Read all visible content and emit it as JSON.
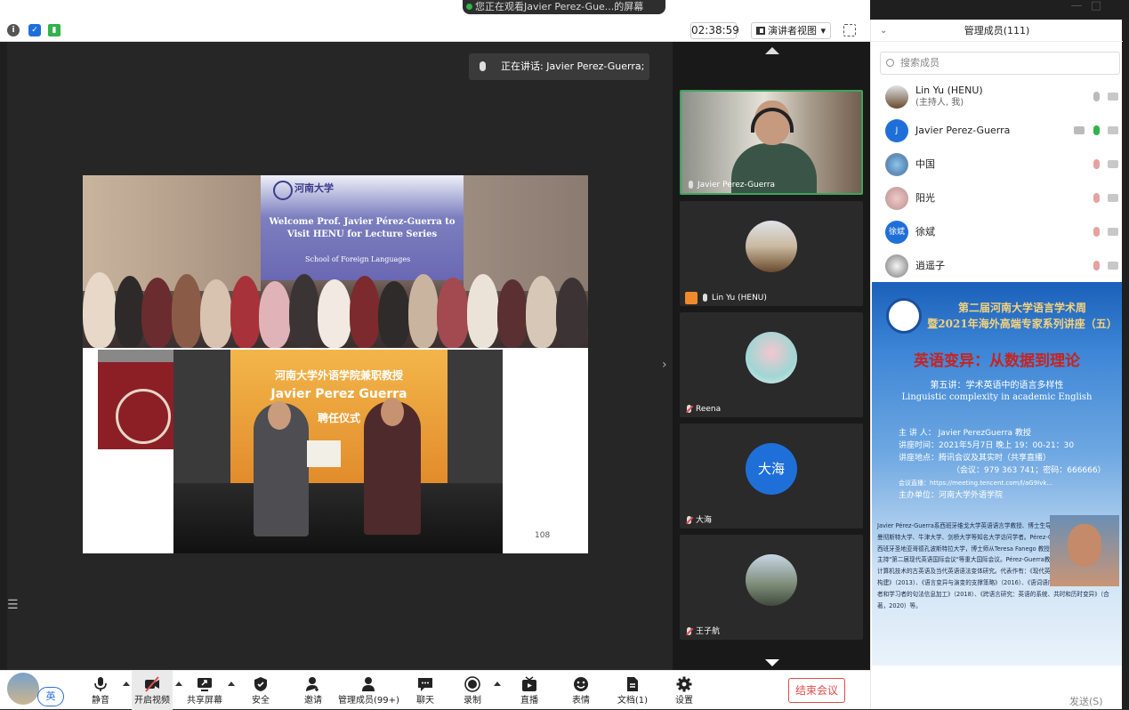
{
  "window": {
    "title": "您正在观看Javier Perez-Gue...的屏幕",
    "minimize": "—",
    "maximize": "□"
  },
  "infobar": {
    "timer": "02:38:59",
    "view_label": "演讲者视图",
    "view_caret": "▾"
  },
  "stage": {
    "speaking": "正在讲话: Javier Perez-Guerra;",
    "right_arrow": "›",
    "left_menu": "☰",
    "slide": {
      "logo_text": "河南大学",
      "welcome": "Welcome Prof. Javier Pérez-Guerra to Visit HENU for Lecture Series",
      "school": "School of Foreign Languages",
      "banner_l1": "河南大学外语学院兼职教授",
      "banner_l2": "Javier Perez Guerra",
      "banner_l3": "聘任仪式",
      "page_number": "108"
    }
  },
  "video_tiles": [
    {
      "name": "Javier Perez-Guerra",
      "state": "speaking"
    },
    {
      "name": "Lin Yu (HENU)",
      "state": "host"
    },
    {
      "name": "Reena",
      "state": "muted"
    },
    {
      "name": "大海",
      "state": "muted",
      "avatar_text": "大海"
    },
    {
      "name": "王子航",
      "state": "muted"
    }
  ],
  "panel": {
    "title": "管理成员(111)",
    "chevron": "⌄",
    "search_placeholder": "搜索成员",
    "members": [
      {
        "name": "Lin Yu (HENU)",
        "sub": "(主持人, 我)",
        "mic": "off",
        "cam": "off"
      },
      {
        "name": "Javier Perez-Guerra",
        "avatar": "J",
        "mic": "on",
        "cam": "off"
      },
      {
        "name": "中国",
        "mic": "muted",
        "cam": "off"
      },
      {
        "name": "阳光",
        "mic": "muted",
        "cam": "off"
      },
      {
        "name": "徐斌",
        "avatar": "徐斌",
        "mic": "muted",
        "cam": "off"
      },
      {
        "name": "逍遥子",
        "mic": "muted",
        "cam": "off"
      }
    ],
    "send_label": "发送(S)"
  },
  "poster": {
    "title_line1": "第二届河南大学语言学术周",
    "title_line2": "暨2021年海外高端专家系列讲座（五）",
    "main_title": "英语变异：从数据到理论",
    "sub_cn": "第五讲：学术英语中的语言多样性",
    "sub_en": "Linguistic complexity in academic English",
    "lines": [
      "主 讲 人：  Javier PerezGuerra  教授",
      "讲座时间：2021年5月7日 晚上 19：00-21：30",
      "讲座地点：腾讯会议及其实时（共享直播）",
      "（会议：979 363 741；密码：666666）",
      "会议直播：https://meeting.tencent.com/l/aG9Ivk...",
      "主办单位：河南大学外语学院"
    ],
    "bio": "Javier Pérez-Guerra系西班牙维戈大学英语语言学教授、博士生导师，知名学术期刊编辑，曼彻斯特大学、牛津大学、剑桥大学等知名大学访问学者。Pérez-Guerra教授暗博导毕业于西班牙圣地亚哥德孔波斯特拉大学，博士师从Teresa Fanego 教授。Pérez-Guerra 教授曾主持\"第二届现代英语国际会议\"等重大国际会议。Pérez-Guerra教授的主要研究领域是基于计算机技术的古英语及当代英语语法变体研究。代表作有：《现代英语文体中语序的继度特征构建》（2013）、《语言变异与演变的支撑策略》（2016）、《语词语序的实证研究：英语母语者和学习者的句法信息加工》（2018）、《跨语言研究：英语的系统、共时和历时变异》（合著，2020）等。"
  },
  "toolbar": {
    "lang": "英",
    "items": [
      {
        "label": "静音"
      },
      {
        "label": "开启视频"
      },
      {
        "label": "共享屏幕"
      },
      {
        "label": "安全"
      },
      {
        "label": "邀请"
      },
      {
        "label": "管理成员(99+)"
      },
      {
        "label": "聊天"
      },
      {
        "label": "录制"
      },
      {
        "label": "直播"
      },
      {
        "label": "表情"
      },
      {
        "label": "文档(1)"
      },
      {
        "label": "设置"
      }
    ],
    "end_label": "结束会议"
  },
  "colors": {
    "accent_blue": "#1f6fd9",
    "active_green": "#3da35d",
    "danger_red": "#e14b4b",
    "host_orange": "#f08a2a"
  }
}
